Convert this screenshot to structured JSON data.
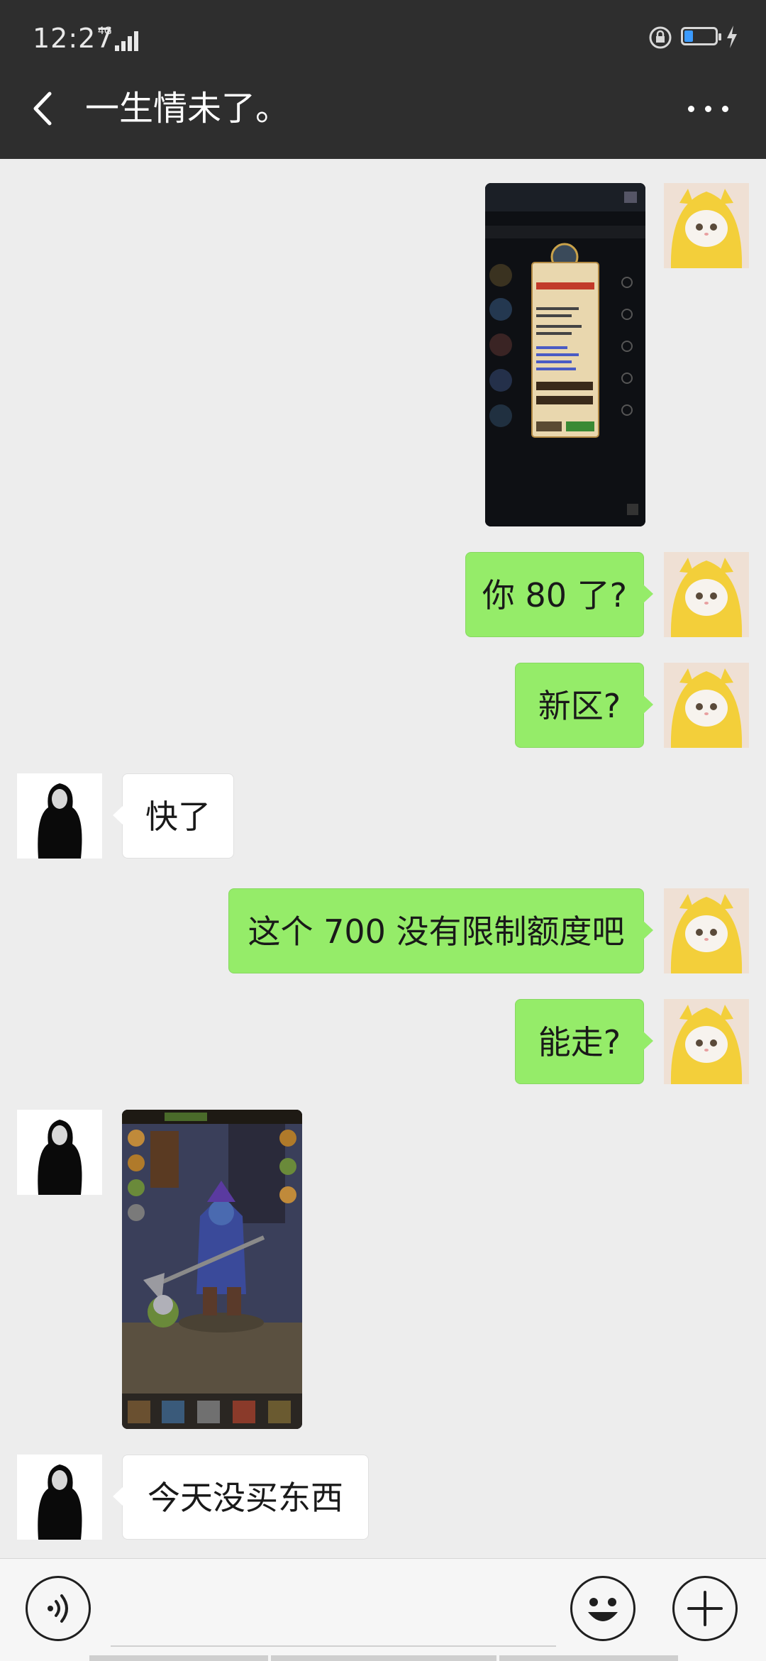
{
  "status_bar": {
    "time": "12:27",
    "network": "4G",
    "icons": [
      "signal-icon",
      "rotation-lock-icon",
      "battery-icon",
      "charging-icon"
    ],
    "battery_level": 0.2,
    "battery_color": "#3b9bff"
  },
  "header": {
    "title": "一生情未了。",
    "back_icon": "chevron-left-icon",
    "more_icon": "more-dots-icon"
  },
  "messages": [
    {
      "sender": "me",
      "type": "image",
      "description": "game-screenshot-shop"
    },
    {
      "sender": "me",
      "type": "text",
      "text": "你 80 了?"
    },
    {
      "sender": "me",
      "type": "text",
      "text": "新区?"
    },
    {
      "sender": "other",
      "type": "text",
      "text": "快了"
    },
    {
      "sender": "me",
      "type": "text",
      "text": "这个 700 没有限制额度吧"
    },
    {
      "sender": "me",
      "type": "text",
      "text": "能走?"
    },
    {
      "sender": "other",
      "type": "image",
      "description": "game-screenshot-hero"
    },
    {
      "sender": "other",
      "type": "text",
      "text": "今天没买东西"
    }
  ],
  "input_bar": {
    "voice_icon": "voice-icon",
    "emoji_icon": "emoji-icon",
    "plus_icon": "plus-icon"
  },
  "colors": {
    "header_bg": "#2e2e2e",
    "chat_bg": "#ededed",
    "my_bubble": "#95ec69",
    "their_bubble": "#ffffff"
  }
}
